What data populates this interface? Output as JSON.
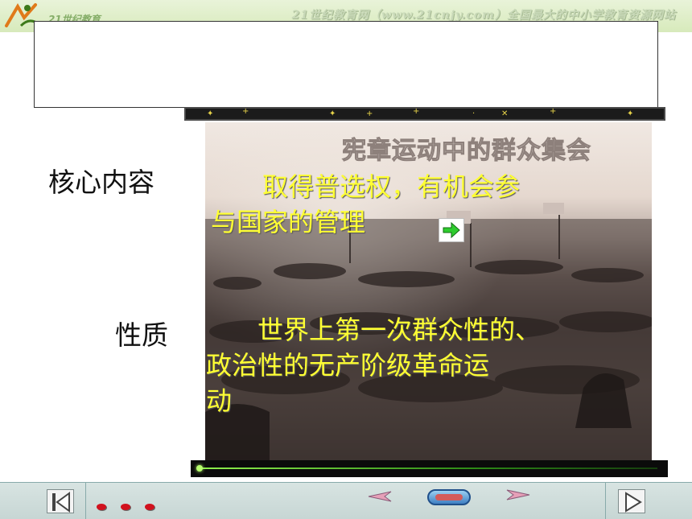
{
  "header": {
    "logo_text": "21世纪教育",
    "site_text": "21世纪教育网（www.21cnjy.com）全国最大的中小学教育资源网站"
  },
  "photo": {
    "caption": "宪章运动中的群众集会"
  },
  "content": {
    "label_core": "核心内容",
    "core_line1": "　　取得普选权，有机会参",
    "core_line2": "与国家的管理",
    "label_nature": "性质",
    "nature_line1": "　　世界上第一次群众性的、",
    "nature_line2": "政治性的无产阶级革命运",
    "nature_line3": "动"
  },
  "nav": {
    "first_icon": "first-page-icon",
    "prev_icon": "prev-arrow-icon",
    "home_icon": "home-oval-icon",
    "next_icon": "next-arrow-icon",
    "play_icon": "play-icon"
  },
  "colors": {
    "highlight_text": "#ffff33",
    "banner_green": "#d7eabb",
    "nav_bg": "#c7d6d4"
  }
}
